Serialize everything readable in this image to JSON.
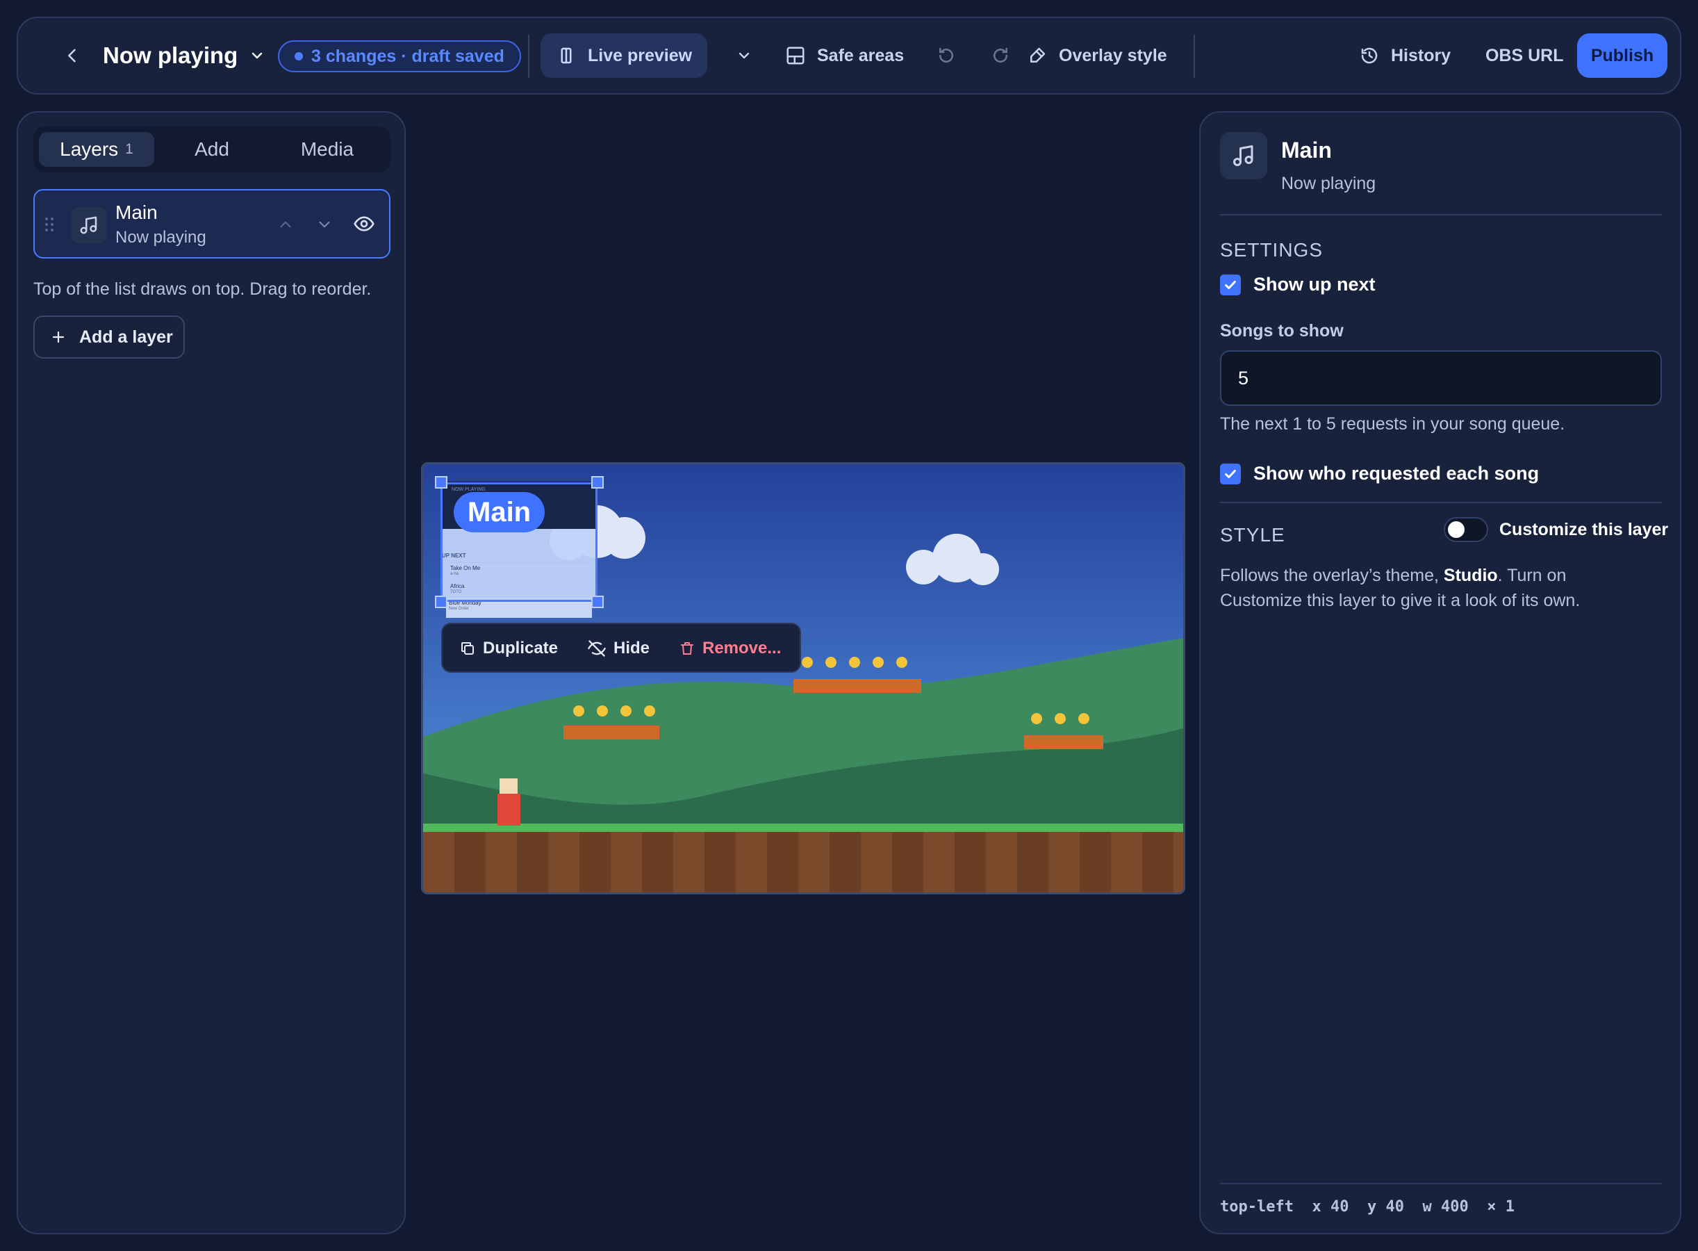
{
  "topbar": {
    "title": "Now playing",
    "changes": "3 changes · draft saved",
    "live_preview": "Live preview",
    "safe_areas": "Safe areas",
    "overlay_style": "Overlay style",
    "history": "History",
    "obs_url": "OBS URL",
    "publish": "Publish"
  },
  "left": {
    "tabs": {
      "layers": "Layers",
      "layers_count": "1",
      "add": "Add",
      "media": "Media"
    },
    "layer": {
      "name": "Main",
      "type": "Now playing"
    },
    "helper": "Top of the list draws on top. Drag to reorder.",
    "add_layer": "Add a layer"
  },
  "canvas": {
    "badge": "Main",
    "widget": {
      "header": "NOW PLAYING",
      "up_next_label": "UP NEXT",
      "rows": [
        {
          "song": "Take On Me",
          "artist": "a-ha",
          "requester": ""
        },
        {
          "song": "Africa",
          "artist": "TOTO",
          "requester": ""
        },
        {
          "song": "Blue Monday",
          "artist": "New Order",
          "requester": ""
        }
      ]
    },
    "menu": {
      "duplicate": "Duplicate",
      "hide": "Hide",
      "remove": "Remove..."
    }
  },
  "right": {
    "title": "Main",
    "subtitle": "Now playing",
    "settings_heading": "SETTINGS",
    "show_up_next": "Show up next",
    "songs_label": "Songs to show",
    "songs_value": "5",
    "songs_help": "The next 1 to 5 requests in your song queue.",
    "show_requester": "Show who requested each song",
    "style_heading": "STYLE",
    "customize_label": "Customize this layer",
    "style_desc_pre": "Follows the overlay’s theme, ",
    "style_theme": "Studio",
    "style_desc_post": ". Turn on Customize this layer to give it a look of its own.",
    "position": {
      "anchor": "top-left",
      "x_label": "x",
      "x": "40",
      "y_label": "y",
      "y": "40",
      "w_label": "w",
      "w": "400",
      "scale_label": "×",
      "scale": "1"
    }
  },
  "colors": {
    "accent": "#3f73ff",
    "panel": "#18223d",
    "background": "#111a30",
    "danger": "#ff7d8e"
  }
}
